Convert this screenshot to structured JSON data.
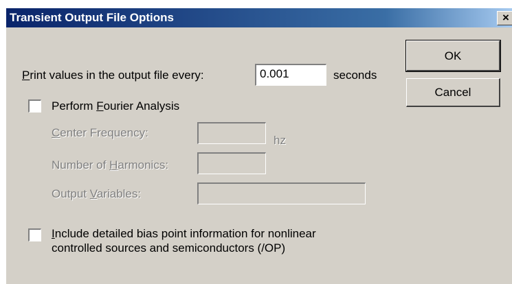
{
  "window": {
    "title": "Transient Output File Options",
    "close_glyph": "×"
  },
  "print_interval": {
    "label_prefix": "P",
    "label_rest": "rint values in the output file every:",
    "value": "0.001",
    "unit": "seconds"
  },
  "buttons": {
    "ok": "OK",
    "cancel": "Cancel"
  },
  "fourier": {
    "checked": false,
    "label_prefix": "Perform ",
    "label_mnemonic": "F",
    "label_rest": "ourier Analysis",
    "center_frequency": {
      "mnemonic": "C",
      "rest": "enter Frequency:",
      "value": "",
      "unit": "hz"
    },
    "harmonics": {
      "prefix": "Number of ",
      "mnemonic": "H",
      "rest": "armonics:",
      "value": ""
    },
    "output_variables": {
      "prefix": "Output ",
      "mnemonic": "V",
      "rest": "ariables:",
      "value": ""
    }
  },
  "bias_point": {
    "checked": false,
    "line1_mnemonic": "I",
    "line1_rest": "nclude detailed bias point information for nonlinear",
    "line2": "controlled sources and semiconductors (/OP)"
  },
  "colors": {
    "face": "#d4d0c8",
    "title_start": "#0a246a",
    "title_end": "#a6caf0",
    "disabled_text": "#808080"
  }
}
